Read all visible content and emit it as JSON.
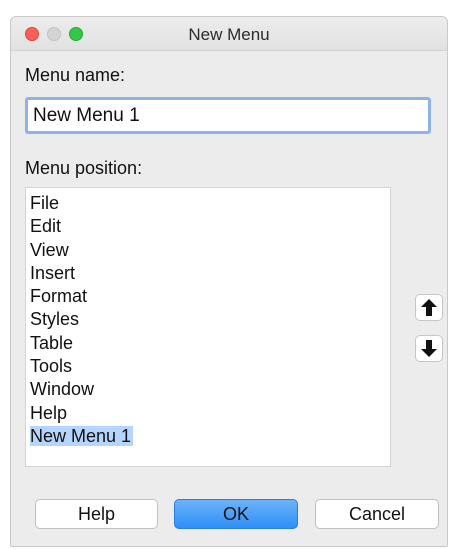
{
  "window": {
    "title": "New Menu"
  },
  "menu_name": {
    "label": "Menu name:",
    "value": "New Menu 1"
  },
  "menu_position": {
    "label": "Menu position:",
    "items": [
      "File",
      "Edit",
      "View",
      "Insert",
      "Format",
      "Styles",
      "Table",
      "Tools",
      "Window",
      "Help",
      "New Menu 1"
    ],
    "selected": "New Menu 1"
  },
  "buttons": {
    "help": "Help",
    "ok": "OK",
    "cancel": "Cancel",
    "move_up_icon": "arrow-up-icon",
    "move_down_icon": "arrow-down-icon"
  },
  "colors": {
    "selection": "#b5d5ff",
    "primary_button": "#2d8ff5",
    "close": "#fc5f57",
    "maximize": "#34c84a"
  }
}
